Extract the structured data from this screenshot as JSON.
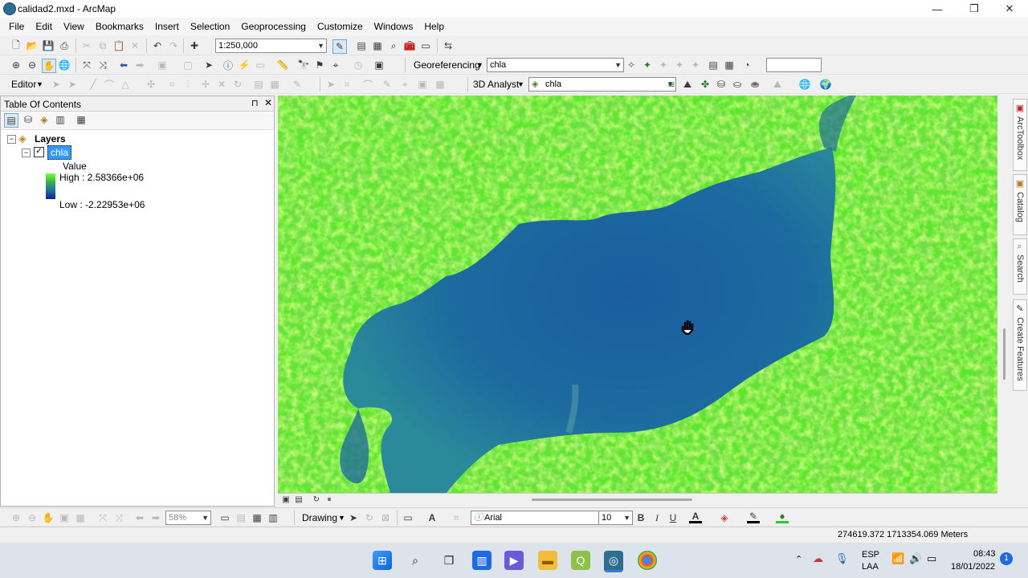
{
  "window": {
    "title": "calidad2.mxd - ArcMap",
    "minimize": "—",
    "maximize": "❐",
    "close": "✕"
  },
  "menu": [
    "File",
    "Edit",
    "View",
    "Bookmarks",
    "Insert",
    "Selection",
    "Geoprocessing",
    "Customize",
    "Windows",
    "Help"
  ],
  "toolbar1": {
    "scale": "1:250,000"
  },
  "toolbar2": {
    "georeferencing_label": "Georeferencing",
    "georef_layer": "chla",
    "search_value": ""
  },
  "toolbar3": {
    "editor_label": "Editor",
    "analyst_label": "3D Analyst",
    "analyst_layer": "chla"
  },
  "toc": {
    "title": "Table Of Contents",
    "pin": "ᵖ",
    "close": "✕",
    "layers_label": "Layers",
    "layer_name": "chla",
    "legend_field": "Value",
    "high_label": "High : 2.58366e+06",
    "low_label": "Low : -2.22953e+06"
  },
  "dock_tabs": [
    "ArcToolbox",
    "Catalog",
    "Search",
    "Create Features"
  ],
  "bottom_toolbar": {
    "zoom_percent": "58%",
    "drawing_label": "Drawing",
    "font_name": "Arial",
    "font_size": "10",
    "bold": "B",
    "italic": "I",
    "underline": "U",
    "font_color": "A"
  },
  "status": {
    "coordinates": "274619.372  1713354.069 Meters"
  },
  "taskbar": {
    "lang": "ESP",
    "lang2": "LAA",
    "time": "08:43",
    "date": "18/01/2022",
    "notification_count": "1"
  },
  "colors": {
    "accent": "#3399ff",
    "land": "#5be82a",
    "water": "#1e6a9e"
  }
}
